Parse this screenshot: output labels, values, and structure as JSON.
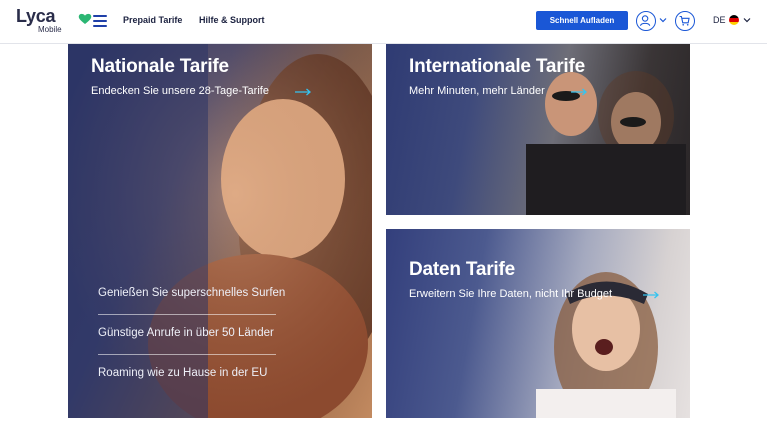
{
  "brand": {
    "name": "Lyca",
    "sub": "Mobile",
    "accent": "#2bb673"
  },
  "header": {
    "nav": [
      "Prepaid Tarife",
      "Hilfe & Support"
    ],
    "cta": "Schnell Aufladen",
    "language": "DE",
    "primary_color": "#1a57d6"
  },
  "cards": {
    "national": {
      "title": "Nationale Tarife",
      "subtitle": "Endecken Sie unsere 28-Tage-Tarife",
      "features": [
        "Genießen Sie superschnelles Surfen",
        "Günstige Anrufe in über 50 Länder",
        "Roaming wie zu Hause in der EU"
      ]
    },
    "international": {
      "title": "Internationale Tarife",
      "subtitle": "Mehr Minuten, mehr Länder"
    },
    "data": {
      "title": "Daten Tarife",
      "subtitle": "Erweitern Sie Ihre Daten, nicht Ihr Budget"
    }
  },
  "icons": [
    "menu-icon",
    "user-icon",
    "chevron-down-icon",
    "cart-icon",
    "german-flag-icon",
    "arrow-right-icon",
    "heart-logo-icon"
  ]
}
